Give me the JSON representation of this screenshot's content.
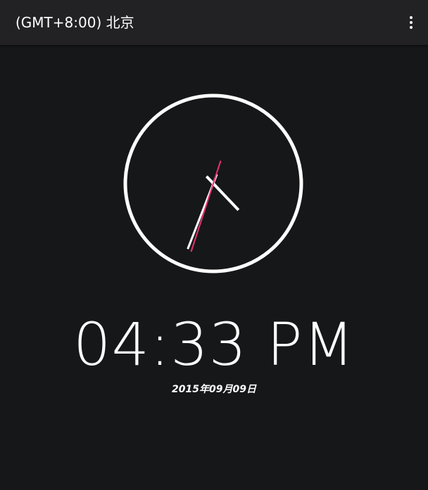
{
  "toolbar": {
    "title": "(GMT+8:00) 北京",
    "menu_icon": "more-vert-icon"
  },
  "analog_clock": {
    "hour": 4,
    "minute": 33,
    "second": 33,
    "second_hand_color": "#e8336d",
    "face_color": "#ffffff"
  },
  "digital_time": "04:33 PM",
  "date": "2015年09月09日"
}
